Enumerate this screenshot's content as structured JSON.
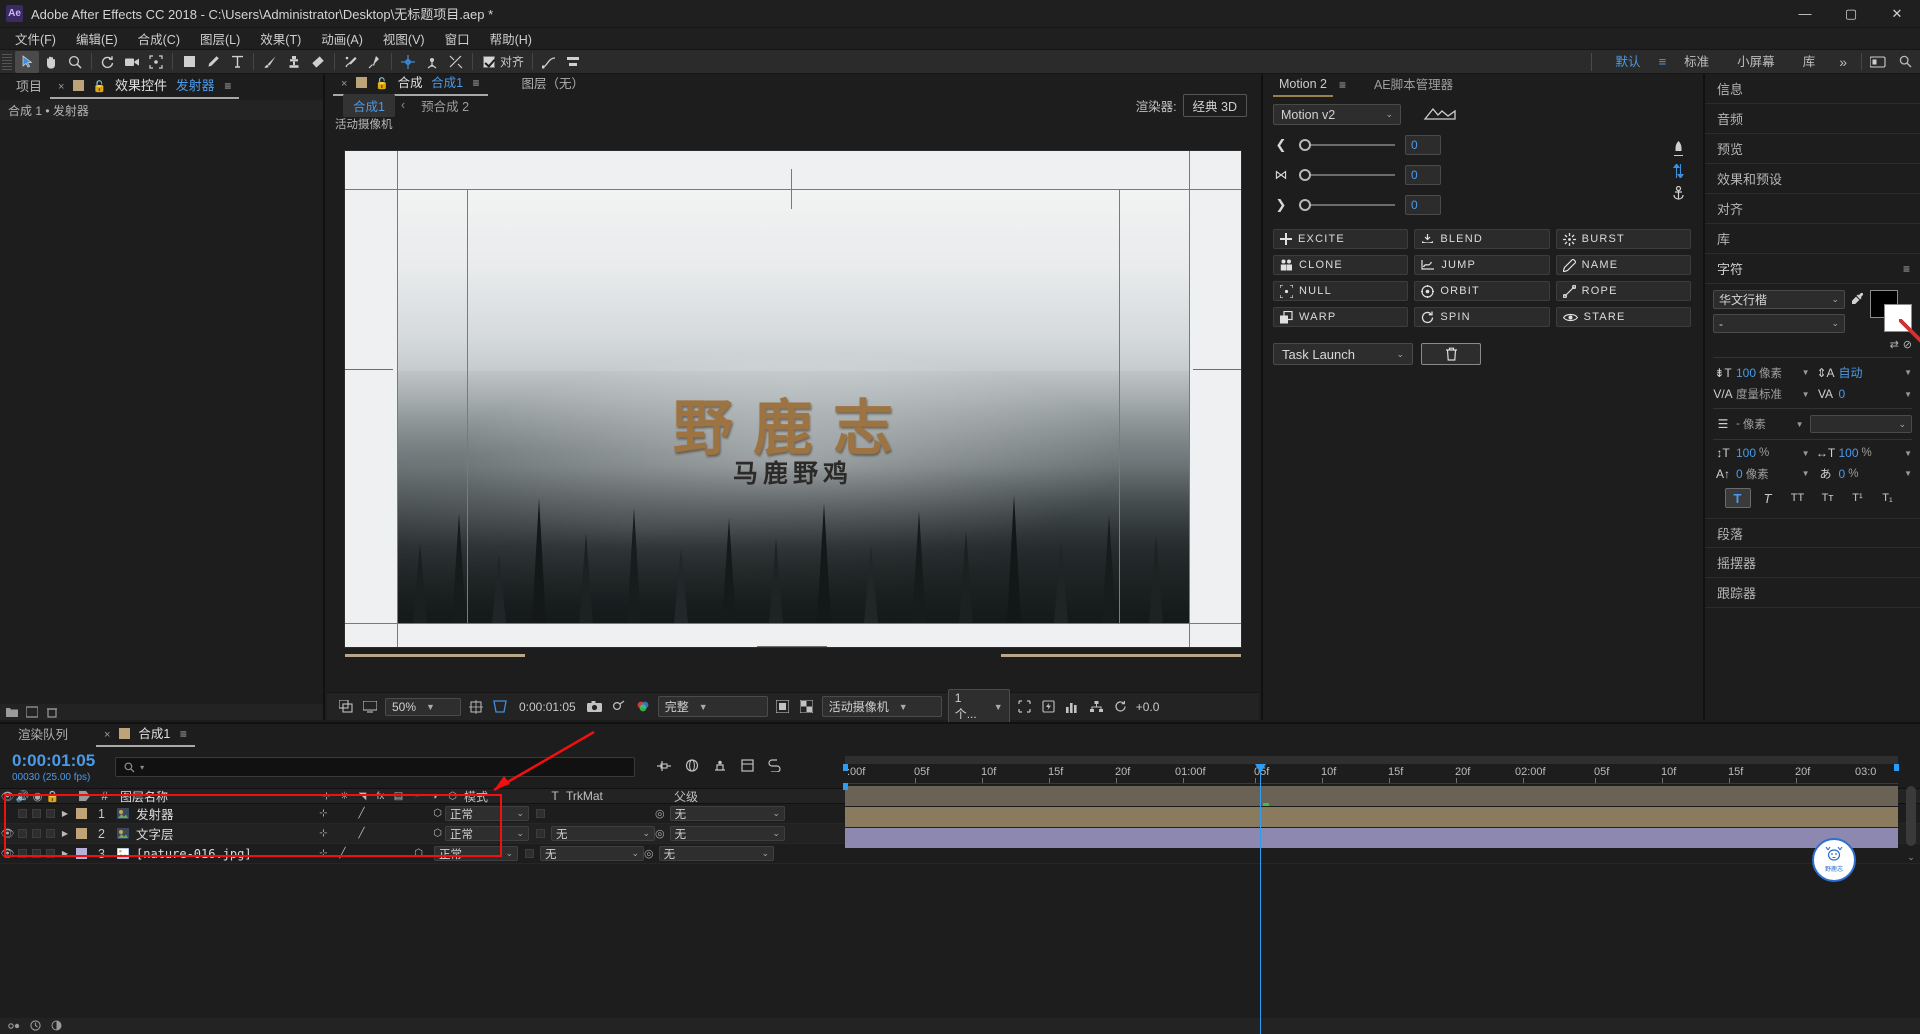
{
  "window": {
    "app_badge": "Ae",
    "title": "Adobe After Effects CC 2018 - C:\\Users\\Administrator\\Desktop\\无标题项目.aep *",
    "minimize": "—",
    "maximize": "▢",
    "close": "✕"
  },
  "menu": {
    "items": [
      "文件(F)",
      "编辑(E)",
      "合成(C)",
      "图层(L)",
      "效果(T)",
      "动画(A)",
      "视图(V)",
      "窗口",
      "帮助(H)"
    ]
  },
  "toolbar": {
    "snap_label": "对齐",
    "workspaces": [
      {
        "label": "默认",
        "active": true
      },
      {
        "label": "标准",
        "active": false
      },
      {
        "label": "小屏幕",
        "active": false
      },
      {
        "label": "库",
        "active": false
      }
    ],
    "more": "»",
    "search_icon": "search-icon"
  },
  "project_panel": {
    "tabs": [
      {
        "label": "项目",
        "selected": false
      },
      {
        "label": "效果控件",
        "selected": true,
        "value": "发射器"
      }
    ],
    "breadcrumb": "合成 1 • 发射器"
  },
  "comp_panel": {
    "tabs": [
      {
        "label": "合成",
        "value": "合成1",
        "selected": true
      },
      {
        "label": "图层（无）",
        "selected": false
      }
    ],
    "sub_tabs": [
      {
        "label": "合成1",
        "active": true
      },
      {
        "label": "预合成 2",
        "active": false
      }
    ],
    "renderer_label": "渲染器:",
    "renderer_value": "经典 3D",
    "viewer_label": "活动摄像机",
    "canvas": {
      "title": "野鹿志",
      "subtitle": "马鹿野鸡"
    },
    "bottom_bar": {
      "zoom": "50%",
      "timecode": "0:00:01:05",
      "quality": "完整",
      "view": "活动摄像机",
      "views_count": "1 个...",
      "exposure": "+0.0"
    }
  },
  "motion_panel": {
    "tabs": [
      {
        "label": "Motion 2",
        "selected": true
      },
      {
        "label": "AE脚本管理器",
        "selected": false
      }
    ],
    "version_dropdown": "Motion v2",
    "sliders": [
      {
        "icon": "chevron-left-icon",
        "value": "0"
      },
      {
        "icon": "collapse-horizontal-icon",
        "value": "0"
      },
      {
        "icon": "chevron-right-icon",
        "value": "0"
      }
    ],
    "side_icons": [
      "rocket-icon",
      "vertical-arrows-icon",
      "anchor-icon"
    ],
    "buttons": [
      {
        "label": "EXCITE",
        "icon": "plus-icon"
      },
      {
        "label": "BLEND",
        "icon": "blend-icon"
      },
      {
        "label": "BURST",
        "icon": "burst-icon"
      },
      {
        "label": "CLONE",
        "icon": "clone-icon"
      },
      {
        "label": "JUMP",
        "icon": "jump-icon"
      },
      {
        "label": "NAME",
        "icon": "pencil-icon"
      },
      {
        "label": "NULL",
        "icon": "null-icon"
      },
      {
        "label": "ORBIT",
        "icon": "orbit-icon"
      },
      {
        "label": "ROPE",
        "icon": "rope-icon"
      },
      {
        "label": "WARP",
        "icon": "warp-icon"
      },
      {
        "label": "SPIN",
        "icon": "spin-icon"
      },
      {
        "label": "STARE",
        "icon": "eye-icon"
      }
    ],
    "task_dropdown": "Task Launch",
    "delete_icon": "trash-icon"
  },
  "right_rail": {
    "items": [
      "信息",
      "音频",
      "预览",
      "效果和预设",
      "对齐",
      "库"
    ],
    "character": {
      "title": "字符",
      "font_family": "华文行楷",
      "font_style": "-",
      "size_value": "100",
      "size_unit": "像素",
      "leading_value": "自动",
      "kerning_value": "度量标准",
      "tracking_value": "0",
      "stroke_value": "-",
      "stroke_unit": "像素",
      "vscale_value": "100",
      "vscale_unit": "%",
      "hscale_value": "100",
      "hscale_unit": "%",
      "baseline_value": "0",
      "baseline_unit": "像素",
      "tsume_value": "0",
      "tsume_unit": "%",
      "styles": [
        "T",
        "T",
        "TT",
        "Tт",
        "T¹",
        "T₁"
      ]
    },
    "extra_items": [
      "段落",
      "摇摆器",
      "跟踪器"
    ]
  },
  "timeline": {
    "tabs": [
      {
        "label": "渲染队列",
        "selected": false
      },
      {
        "label": "合成1",
        "selected": true
      }
    ],
    "timecode": "0:00:01:05",
    "frame_info": "00030 (25.00 fps)",
    "search_placeholder": "",
    "columns": [
      "图层名称",
      "模式",
      "T",
      "TrkMat",
      "父级"
    ],
    "layers": [
      {
        "index": "1",
        "name": "发射器",
        "color": "#c0a376",
        "type_icon": "comp-icon",
        "visible": false,
        "mode": "正常",
        "trkmat": "",
        "parent": "无",
        "bar_color": "#6b6256"
      },
      {
        "index": "2",
        "name": "文字层",
        "color": "#c0a376",
        "type_icon": "comp-icon",
        "visible": true,
        "mode": "正常",
        "trkmat": "无",
        "parent": "无",
        "bar_color": "#8a7a5e"
      },
      {
        "index": "3",
        "name": "[nature-016.jpg]",
        "color": "#b6b1d6",
        "type_icon": "image-icon",
        "visible": true,
        "mode": "正常",
        "trkmat": "无",
        "parent": "无",
        "bar_color": "#8c88b0"
      }
    ],
    "ruler_ticks": [
      ":00f",
      "05f",
      "10f",
      "15f",
      "20f",
      "01:00f",
      "05f",
      "10f",
      "15f",
      "20f",
      "02:00f",
      "05f",
      "10f",
      "15f",
      "20f",
      "03:0"
    ],
    "playhead_label": "0f"
  },
  "watermark": {
    "line1": "野",
    "line2": "野鹿志"
  },
  "colors": {
    "accent_blue": "#4b9ae8",
    "annotation_red": "#f01010",
    "panel_bg": "#1d1d1d",
    "title_gold": "#9c7341"
  }
}
